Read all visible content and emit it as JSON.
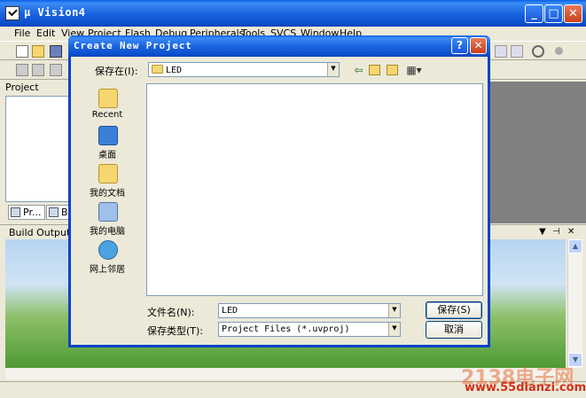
{
  "app": {
    "title": "µ Vision4",
    "menu": [
      "File",
      "Edit",
      "View",
      "Project",
      "Flash",
      "Debug",
      "Peripherals",
      "Tools",
      "SVCS",
      "Window",
      "Help"
    ]
  },
  "project_pane": {
    "header": "Project",
    "tabs": [
      "Pr...",
      "Bo..."
    ]
  },
  "build_output": {
    "header": "Build Output"
  },
  "dialog": {
    "title": "Create New Project",
    "look_in_label": "保存在(I):",
    "look_in_value": "LED",
    "places": [
      "Recent",
      "桌面",
      "我的文档",
      "我的电脑",
      "网上邻居"
    ],
    "file_name_label": "文件名(N):",
    "file_name_value": "LED",
    "file_type_label": "保存类型(T):",
    "file_type_value": "Project Files (*.uvproj)",
    "save_button": "保存(S)",
    "cancel_button": "取消"
  },
  "watermark": {
    "brand": "2138电子网",
    "url": "www.55dianzi.com"
  },
  "colors": {
    "titlebar": "#0a4ecb",
    "dialog_bg": "#ece9d8",
    "url_text": "#d0301a"
  },
  "icons": [
    "app-icon",
    "minimize-icon",
    "maximize-icon",
    "close-icon",
    "help-icon",
    "folder-icon",
    "back-icon",
    "up-folder-icon",
    "new-folder-icon",
    "view-menu-icon",
    "recent-icon",
    "desktop-icon",
    "my-documents-icon",
    "my-computer-icon",
    "network-places-icon"
  ]
}
